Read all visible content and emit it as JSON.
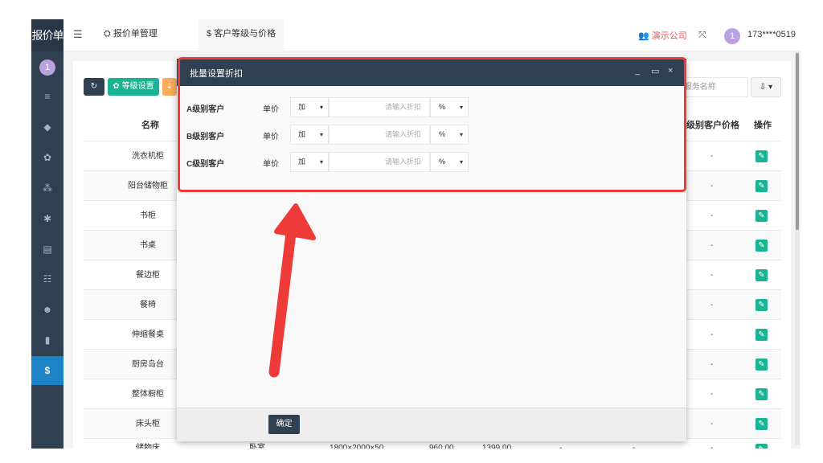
{
  "app": {
    "logo": "报价单",
    "sidebar_avatar": "1"
  },
  "topbar": {
    "menu_icon": "☰",
    "tabs": [
      {
        "icon": "⛭",
        "label": "报价单管理"
      },
      {
        "icon": "$",
        "label": "客户等级与价格"
      }
    ],
    "company": "演示公司",
    "company_icon": "👥",
    "expand_icon": "⤧",
    "avatar": "1",
    "user": "173****0519"
  },
  "sidebar": {
    "items": [
      {
        "icon": "≡"
      },
      {
        "icon": "◆"
      },
      {
        "icon": "✿"
      },
      {
        "icon": "⁂"
      },
      {
        "icon": "✱"
      },
      {
        "icon": "▤"
      },
      {
        "icon": "☷"
      },
      {
        "icon": "☻"
      },
      {
        "icon": "▮"
      },
      {
        "icon": "$"
      }
    ]
  },
  "toolbar": {
    "refresh_icon": "↻",
    "level_settings_label": "✿ 等级设置",
    "import_icon": "⇣",
    "search_placeholder_tail": "/服务名称",
    "export_icon": "⇩ ▾"
  },
  "table": {
    "headers": {
      "name": "名称",
      "level_price": "级别客户价格",
      "actions": "操作"
    },
    "rows": [
      {
        "name": "洗衣机柜",
        "price": "-"
      },
      {
        "name": "阳台储物柜",
        "price": "-"
      },
      {
        "name": "书柜",
        "price": "-"
      },
      {
        "name": "书桌",
        "price": "-"
      },
      {
        "name": "餐边柜",
        "price": "-"
      },
      {
        "name": "餐椅",
        "price": "-"
      },
      {
        "name": "伸缩餐桌",
        "price": "-"
      },
      {
        "name": "厨房岛台",
        "price": "-"
      },
      {
        "name": "整体橱柜",
        "price": "-"
      },
      {
        "name": "床头柜",
        "price": "-"
      },
      {
        "name": "储物床",
        "price": "-",
        "category": "卧室",
        "size": "1800×2000×50...",
        "cost": "960.00",
        "sale": "1399.00",
        "c1": "-",
        "c2": "-"
      }
    ],
    "edit_icon": "✎"
  },
  "dialog": {
    "title": "批量设置折扣",
    "minimize_icon": "_",
    "maximize_icon": "▭",
    "close_icon": "×",
    "rows": [
      {
        "level": "A级别客户",
        "unit": "单价",
        "op": "加",
        "placeholder": "请输入折扣",
        "mode": "%"
      },
      {
        "level": "B级别客户",
        "unit": "单价",
        "op": "加",
        "placeholder": "请输入折扣",
        "mode": "%"
      },
      {
        "level": "C级别客户",
        "unit": "单价",
        "op": "加",
        "placeholder": "请输入折扣",
        "mode": "%"
      }
    ],
    "caret": "▾",
    "confirm_label": "确定"
  },
  "annotation": {
    "color": "#ef3a3a"
  }
}
